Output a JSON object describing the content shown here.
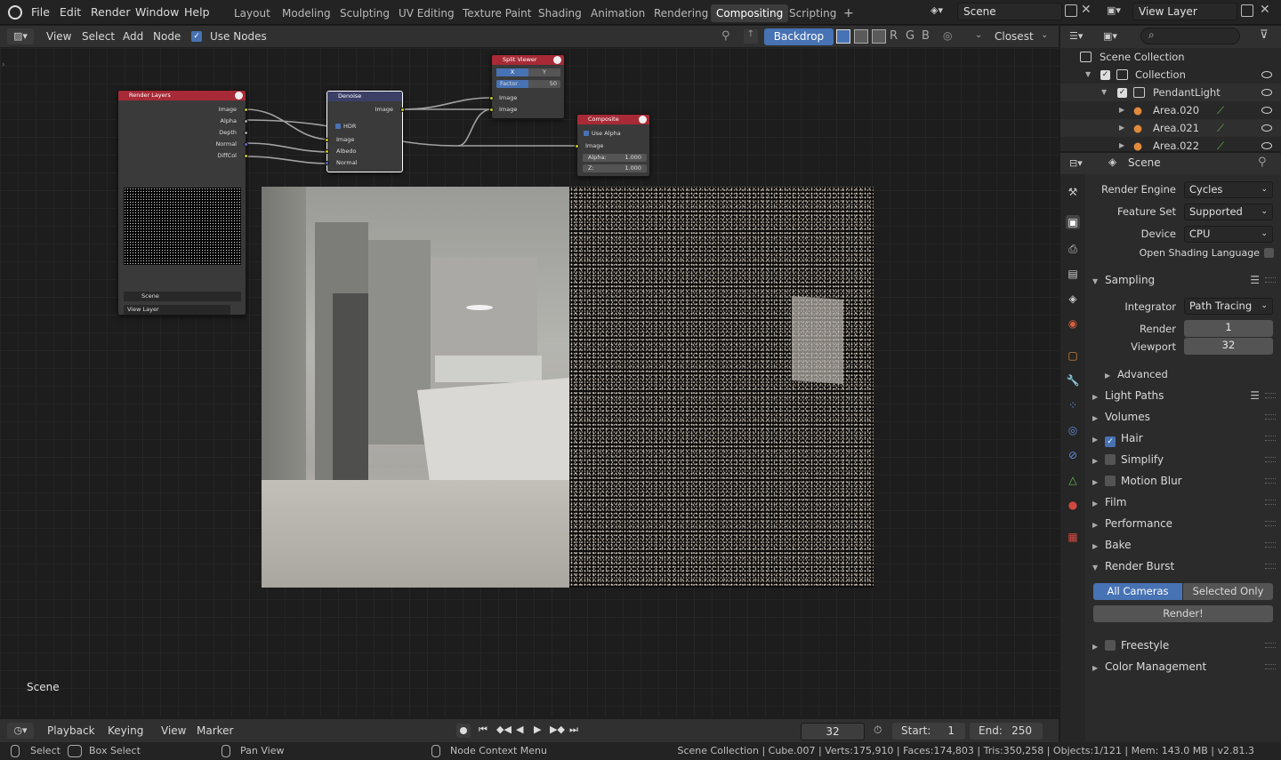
{
  "topbar": {
    "menus": [
      "File",
      "Edit",
      "Render",
      "Window",
      "Help"
    ],
    "workspaces": [
      "Layout",
      "Modeling",
      "Sculpting",
      "UV Editing",
      "Texture Paint",
      "Shading",
      "Animation",
      "Rendering",
      "Compositing",
      "Scripting"
    ],
    "active_workspace": "Compositing",
    "add_tab": "+",
    "scene": "Scene",
    "view_layer": "View Layer"
  },
  "node_header": {
    "menus": [
      "View",
      "Select",
      "Add",
      "Node"
    ],
    "use_nodes": "Use Nodes",
    "backdrop": "Backdrop",
    "channels": [
      "R",
      "G",
      "B"
    ],
    "interp": "Closest"
  },
  "nodes": {
    "render_layers": {
      "title": "Render Layers",
      "outputs": [
        "Image",
        "Alpha",
        "Depth",
        "Normal",
        "DiffCol"
      ],
      "scene": "Scene",
      "view_layer": "View Layer"
    },
    "denoise": {
      "title": "Denoise",
      "output": "Image",
      "hdr": "HDR",
      "inputs": [
        "Image",
        "Albedo",
        "Normal"
      ]
    },
    "split_viewer": {
      "title": "Split Viewer",
      "axis": [
        "X",
        "Y"
      ],
      "factor_label": "Factor",
      "factor": "50",
      "inputs": [
        "Image",
        "Image"
      ]
    },
    "composite": {
      "title": "Composite",
      "use_alpha": "Use Alpha",
      "input": "Image",
      "alpha_label": "Alpha:",
      "alpha": "1.000",
      "z_label": "Z:",
      "z": "1.000"
    }
  },
  "editor_label": "Scene",
  "timeline": {
    "menus": [
      "Playback",
      "Keying",
      "View",
      "Marker"
    ],
    "frame": "32",
    "start_label": "Start:",
    "start": "1",
    "end_label": "End:",
    "end": "250"
  },
  "status": {
    "select": "Select",
    "box_select": "Box Select",
    "pan_view": "Pan View",
    "context_menu": "Node Context Menu",
    "stats": "Scene Collection | Cube.007 | Verts:175,910 | Faces:174,803 | Tris:350,258 | Objects:1/121 | Mem: 143.0 MB | v2.81.3"
  },
  "outliner": {
    "rows": [
      {
        "label": "Scene Collection"
      },
      {
        "label": "Collection"
      },
      {
        "label": "PendantLight"
      },
      {
        "label": "Area.020"
      },
      {
        "label": "Area.021"
      },
      {
        "label": "Area.022"
      }
    ]
  },
  "properties": {
    "context": "Scene",
    "render_engine_label": "Render Engine",
    "render_engine": "Cycles",
    "feature_set_label": "Feature Set",
    "feature_set": "Supported",
    "device_label": "Device",
    "device": "CPU",
    "osl_label": "Open Shading Language",
    "sampling": "Sampling",
    "integrator_label": "Integrator",
    "integrator": "Path Tracing",
    "render_label": "Render",
    "render_samples": "1",
    "viewport_label": "Viewport",
    "viewport_samples": "32",
    "advanced": "Advanced",
    "panels": [
      "Light Paths",
      "Volumes",
      "Hair",
      "Simplify",
      "Motion Blur",
      "Film",
      "Performance",
      "Bake",
      "Render Burst"
    ],
    "burst_all": "All Cameras",
    "burst_selected": "Selected Only",
    "render_btn": "Render!",
    "freestyle": "Freestyle",
    "color_mgmt": "Color Management"
  },
  "colors": {
    "accent": "#4772b3",
    "node_red": "#a72a36",
    "node_blue": "#3b3f66",
    "socket_yellow": "#c7c729"
  }
}
